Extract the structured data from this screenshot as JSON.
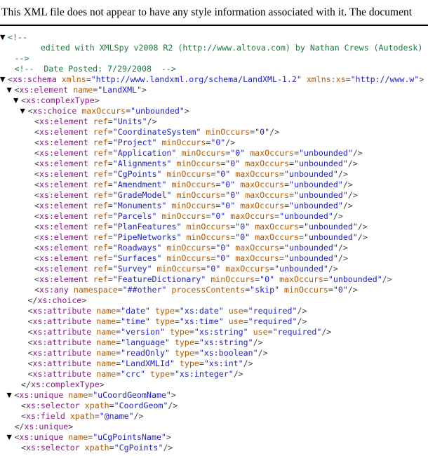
{
  "notice": {
    "text": "This XML file does not appear to have any style information associated with it. The document"
  },
  "colors": {
    "tag": "#8b1a8b",
    "attribute_name": "#b35900",
    "attribute_value": "#2222cc",
    "comment": "#1a7a3c",
    "punctuation": "#444444",
    "background": "#ffffff",
    "notice_text": "#000000"
  },
  "icons": {
    "expanded_twisty": "▼"
  },
  "tree": [
    {
      "indent": 0,
      "twisty": true,
      "type": "comment",
      "text": "<!--"
    },
    {
      "indent": 2,
      "twisty": false,
      "type": "comment",
      "text": "    edited with XMLSpy v2008 R2 (http://www.altova.com) by Nathan Crews (Autodesk)"
    },
    {
      "indent": 1,
      "twisty": false,
      "type": "comment",
      "text": "-->"
    },
    {
      "indent": 1,
      "twisty": false,
      "type": "comment",
      "text": "<!--  Date Posted: 7/29/2008  -->"
    },
    {
      "indent": 0,
      "twisty": true,
      "type": "tag",
      "tag": "xs:schema",
      "selfclose": false,
      "close": false,
      "attrs": [
        {
          "name": "xmlns",
          "value": "http://www.landxml.org/schema/LandXML-1.2"
        },
        {
          "name": "xmlns:xs",
          "value": "http://www.w"
        }
      ]
    },
    {
      "indent": 1,
      "twisty": true,
      "type": "tag",
      "tag": "xs:element",
      "selfclose": false,
      "close": false,
      "attrs": [
        {
          "name": "name",
          "value": "LandXML"
        }
      ]
    },
    {
      "indent": 2,
      "twisty": true,
      "type": "tag",
      "tag": "xs:complexType",
      "selfclose": false,
      "close": false,
      "attrs": []
    },
    {
      "indent": 3,
      "twisty": true,
      "type": "tag",
      "tag": "xs:choice",
      "selfclose": false,
      "close": false,
      "attrs": [
        {
          "name": "maxOccurs",
          "value": "unbounded"
        }
      ]
    },
    {
      "indent": 4,
      "twisty": false,
      "type": "tag",
      "tag": "xs:element",
      "selfclose": true,
      "close": false,
      "attrs": [
        {
          "name": "ref",
          "value": "Units"
        }
      ]
    },
    {
      "indent": 4,
      "twisty": false,
      "type": "tag",
      "tag": "xs:element",
      "selfclose": true,
      "close": false,
      "attrs": [
        {
          "name": "ref",
          "value": "CoordinateSystem"
        },
        {
          "name": "minOccurs",
          "value": "0"
        }
      ]
    },
    {
      "indent": 4,
      "twisty": false,
      "type": "tag",
      "tag": "xs:element",
      "selfclose": true,
      "close": false,
      "attrs": [
        {
          "name": "ref",
          "value": "Project"
        },
        {
          "name": "minOccurs",
          "value": "0"
        }
      ]
    },
    {
      "indent": 4,
      "twisty": false,
      "type": "tag",
      "tag": "xs:element",
      "selfclose": true,
      "close": false,
      "attrs": [
        {
          "name": "ref",
          "value": "Application"
        },
        {
          "name": "minOccurs",
          "value": "0"
        },
        {
          "name": "maxOccurs",
          "value": "unbounded"
        }
      ]
    },
    {
      "indent": 4,
      "twisty": false,
      "type": "tag",
      "tag": "xs:element",
      "selfclose": true,
      "close": false,
      "attrs": [
        {
          "name": "ref",
          "value": "Alignments"
        },
        {
          "name": "minOccurs",
          "value": "0"
        },
        {
          "name": "maxOccurs",
          "value": "unbounded"
        }
      ]
    },
    {
      "indent": 4,
      "twisty": false,
      "type": "tag",
      "tag": "xs:element",
      "selfclose": true,
      "close": false,
      "attrs": [
        {
          "name": "ref",
          "value": "CgPoints"
        },
        {
          "name": "minOccurs",
          "value": "0"
        },
        {
          "name": "maxOccurs",
          "value": "unbounded"
        }
      ]
    },
    {
      "indent": 4,
      "twisty": false,
      "type": "tag",
      "tag": "xs:element",
      "selfclose": true,
      "close": false,
      "attrs": [
        {
          "name": "ref",
          "value": "Amendment"
        },
        {
          "name": "minOccurs",
          "value": "0"
        },
        {
          "name": "maxOccurs",
          "value": "unbounded"
        }
      ]
    },
    {
      "indent": 4,
      "twisty": false,
      "type": "tag",
      "tag": "xs:element",
      "selfclose": true,
      "close": false,
      "attrs": [
        {
          "name": "ref",
          "value": "GradeModel"
        },
        {
          "name": "minOccurs",
          "value": "0"
        },
        {
          "name": "maxOccurs",
          "value": "unbounded"
        }
      ]
    },
    {
      "indent": 4,
      "twisty": false,
      "type": "tag",
      "tag": "xs:element",
      "selfclose": true,
      "close": false,
      "attrs": [
        {
          "name": "ref",
          "value": "Monuments"
        },
        {
          "name": "minOccurs",
          "value": "0"
        },
        {
          "name": "maxOccurs",
          "value": "unbounded"
        }
      ]
    },
    {
      "indent": 4,
      "twisty": false,
      "type": "tag",
      "tag": "xs:element",
      "selfclose": true,
      "close": false,
      "attrs": [
        {
          "name": "ref",
          "value": "Parcels"
        },
        {
          "name": "minOccurs",
          "value": "0"
        },
        {
          "name": "maxOccurs",
          "value": "unbounded"
        }
      ]
    },
    {
      "indent": 4,
      "twisty": false,
      "type": "tag",
      "tag": "xs:element",
      "selfclose": true,
      "close": false,
      "attrs": [
        {
          "name": "ref",
          "value": "PlanFeatures"
        },
        {
          "name": "minOccurs",
          "value": "0"
        },
        {
          "name": "maxOccurs",
          "value": "unbounded"
        }
      ]
    },
    {
      "indent": 4,
      "twisty": false,
      "type": "tag",
      "tag": "xs:element",
      "selfclose": true,
      "close": false,
      "attrs": [
        {
          "name": "ref",
          "value": "PipeNetworks"
        },
        {
          "name": "minOccurs",
          "value": "0"
        },
        {
          "name": "maxOccurs",
          "value": "unbounded"
        }
      ]
    },
    {
      "indent": 4,
      "twisty": false,
      "type": "tag",
      "tag": "xs:element",
      "selfclose": true,
      "close": false,
      "attrs": [
        {
          "name": "ref",
          "value": "Roadways"
        },
        {
          "name": "minOccurs",
          "value": "0"
        },
        {
          "name": "maxOccurs",
          "value": "unbounded"
        }
      ]
    },
    {
      "indent": 4,
      "twisty": false,
      "type": "tag",
      "tag": "xs:element",
      "selfclose": true,
      "close": false,
      "attrs": [
        {
          "name": "ref",
          "value": "Surfaces"
        },
        {
          "name": "minOccurs",
          "value": "0"
        },
        {
          "name": "maxOccurs",
          "value": "unbounded"
        }
      ]
    },
    {
      "indent": 4,
      "twisty": false,
      "type": "tag",
      "tag": "xs:element",
      "selfclose": true,
      "close": false,
      "attrs": [
        {
          "name": "ref",
          "value": "Survey"
        },
        {
          "name": "minOccurs",
          "value": "0"
        },
        {
          "name": "maxOccurs",
          "value": "unbounded"
        }
      ]
    },
    {
      "indent": 4,
      "twisty": false,
      "type": "tag",
      "tag": "xs:element",
      "selfclose": true,
      "close": false,
      "attrs": [
        {
          "name": "ref",
          "value": "FeatureDictionary"
        },
        {
          "name": "minOccurs",
          "value": "0"
        },
        {
          "name": "maxOccurs",
          "value": "unbounded"
        }
      ]
    },
    {
      "indent": 4,
      "twisty": false,
      "type": "tag",
      "tag": "xs:any",
      "selfclose": true,
      "close": false,
      "attrs": [
        {
          "name": "namespace",
          "value": "##other"
        },
        {
          "name": "processContents",
          "value": "skip"
        },
        {
          "name": "minOccurs",
          "value": "0"
        }
      ]
    },
    {
      "indent": 3,
      "twisty": false,
      "type": "tag",
      "tag": "xs:choice",
      "selfclose": false,
      "close": true,
      "attrs": []
    },
    {
      "indent": 3,
      "twisty": false,
      "type": "tag",
      "tag": "xs:attribute",
      "selfclose": true,
      "close": false,
      "attrs": [
        {
          "name": "name",
          "value": "date"
        },
        {
          "name": "type",
          "value": "xs:date"
        },
        {
          "name": "use",
          "value": "required"
        }
      ]
    },
    {
      "indent": 3,
      "twisty": false,
      "type": "tag",
      "tag": "xs:attribute",
      "selfclose": true,
      "close": false,
      "attrs": [
        {
          "name": "name",
          "value": "time"
        },
        {
          "name": "type",
          "value": "xs:time"
        },
        {
          "name": "use",
          "value": "required"
        }
      ]
    },
    {
      "indent": 3,
      "twisty": false,
      "type": "tag",
      "tag": "xs:attribute",
      "selfclose": true,
      "close": false,
      "attrs": [
        {
          "name": "name",
          "value": "version"
        },
        {
          "name": "type",
          "value": "xs:string"
        },
        {
          "name": "use",
          "value": "required"
        }
      ]
    },
    {
      "indent": 3,
      "twisty": false,
      "type": "tag",
      "tag": "xs:attribute",
      "selfclose": true,
      "close": false,
      "attrs": [
        {
          "name": "name",
          "value": "language"
        },
        {
          "name": "type",
          "value": "xs:string"
        }
      ]
    },
    {
      "indent": 3,
      "twisty": false,
      "type": "tag",
      "tag": "xs:attribute",
      "selfclose": true,
      "close": false,
      "attrs": [
        {
          "name": "name",
          "value": "readOnly"
        },
        {
          "name": "type",
          "value": "xs:boolean"
        }
      ]
    },
    {
      "indent": 3,
      "twisty": false,
      "type": "tag",
      "tag": "xs:attribute",
      "selfclose": true,
      "close": false,
      "attrs": [
        {
          "name": "name",
          "value": "LandXMLId"
        },
        {
          "name": "type",
          "value": "xs:int"
        }
      ]
    },
    {
      "indent": 3,
      "twisty": false,
      "type": "tag",
      "tag": "xs:attribute",
      "selfclose": true,
      "close": false,
      "attrs": [
        {
          "name": "name",
          "value": "crc"
        },
        {
          "name": "type",
          "value": "xs:integer"
        }
      ]
    },
    {
      "indent": 2,
      "twisty": false,
      "type": "tag",
      "tag": "xs:complexType",
      "selfclose": false,
      "close": true,
      "attrs": []
    },
    {
      "indent": 1,
      "twisty": true,
      "type": "tag",
      "tag": "xs:unique",
      "selfclose": false,
      "close": false,
      "attrs": [
        {
          "name": "name",
          "value": "uCoordGeomName"
        }
      ]
    },
    {
      "indent": 2,
      "twisty": false,
      "type": "tag",
      "tag": "xs:selector",
      "selfclose": true,
      "close": false,
      "attrs": [
        {
          "name": "xpath",
          "value": "CoordGeom"
        }
      ]
    },
    {
      "indent": 2,
      "twisty": false,
      "type": "tag",
      "tag": "xs:field",
      "selfclose": true,
      "close": false,
      "attrs": [
        {
          "name": "xpath",
          "value": "@name"
        }
      ]
    },
    {
      "indent": 1,
      "twisty": false,
      "type": "tag",
      "tag": "xs:unique",
      "selfclose": false,
      "close": true,
      "attrs": []
    },
    {
      "indent": 1,
      "twisty": true,
      "type": "tag",
      "tag": "xs:unique",
      "selfclose": false,
      "close": false,
      "attrs": [
        {
          "name": "name",
          "value": "uCgPointsName"
        }
      ]
    },
    {
      "indent": 2,
      "twisty": false,
      "type": "tag",
      "tag": "xs:selector",
      "selfclose": true,
      "close": false,
      "attrs": [
        {
          "name": "xpath",
          "value": "CgPoints"
        }
      ]
    }
  ]
}
